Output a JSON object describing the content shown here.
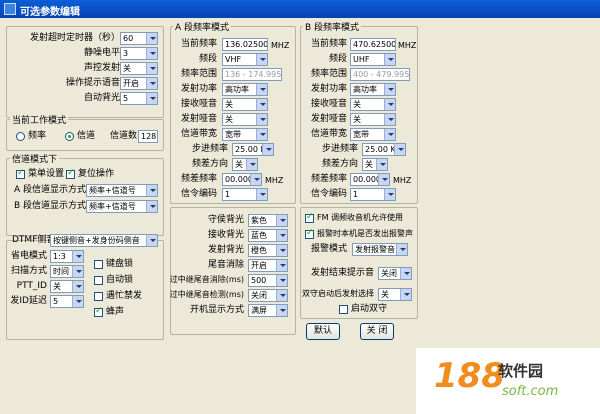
{
  "window": {
    "title": "可选参数编辑"
  },
  "general": {
    "tx_timer_label": "发射超时定时器（秒）",
    "tx_timer_value": "60",
    "squelch_label": "静噪电平",
    "squelch_value": "3",
    "vox_label": "声控发射",
    "vox_value": "关",
    "voice_prompt_label": "操作提示语音",
    "voice_prompt_value": "开启",
    "auto_backlight_label": "自动背光",
    "auto_backlight_value": "5"
  },
  "work_mode": {
    "legend": "当前工作模式",
    "frequency_label": "频率",
    "channel_label": "信道",
    "channel_count_label": "信道数",
    "channel_count_value": "128"
  },
  "channel_mode": {
    "legend": "信道模式下",
    "menu_setting_label": "菜单设置",
    "reset_label": "复位操作",
    "a_display_label": "A 段信道显示方式",
    "a_display_value": "频率+信道号",
    "b_display_label": "B 段信道显示方式",
    "b_display_value": "频率+信道号"
  },
  "a_band": {
    "legend": "A 段频率模式",
    "current_freq_label": "当前频率",
    "current_freq_value": "136.02500",
    "freq_unit": "MHZ",
    "band_label": "频段",
    "band_value": "VHF",
    "range_label": "频率范围",
    "range_value": "136 - 174.9950",
    "power_label": "发射功率",
    "power_value": "高功率",
    "rx_tone_label": "接收哑音",
    "rx_tone_value": "关",
    "tx_tone_label": "发射哑音",
    "tx_tone_value": "关",
    "bandwidth_label": "信道带宽",
    "bandwidth_value": "宽带",
    "step_label": "步进频率",
    "step_value": "25.00 KHZ",
    "offset_dir_label": "频差方向",
    "offset_dir_value": "关",
    "offset_freq_label": "频差频率",
    "offset_freq_value": "00.000M",
    "offset_unit": "MHZ",
    "code_label": "信令编码",
    "code_value": "1"
  },
  "b_band": {
    "legend": "B 段频率模式",
    "current_freq_label": "当前频率",
    "current_freq_value": "470.62500",
    "freq_unit": "MHZ",
    "band_label": "频段",
    "band_value": "UHF",
    "range_label": "频率范围",
    "range_value": "400 - 479.9950",
    "power_label": "发射功率",
    "power_value": "高功率",
    "rx_tone_label": "接收哑音",
    "rx_tone_value": "关",
    "tx_tone_label": "发射哑音",
    "tx_tone_value": "关",
    "bandwidth_label": "信道带宽",
    "bandwidth_value": "宽带",
    "step_label": "步进频率",
    "step_value": "25.00 KHZ",
    "offset_dir_label": "频差方向",
    "offset_dir_value": "关",
    "offset_freq_label": "频差频率",
    "offset_freq_value": "00.000M",
    "offset_unit": "MHZ",
    "code_label": "信令编码",
    "code_value": "1"
  },
  "misc": {
    "dtmf_label": "DTMF侧音",
    "dtmf_value": "按键侧音+发身份码侧音",
    "save_mode_label": "省电模式",
    "save_mode_value": "1:3",
    "scan_mode_label": "扫描方式",
    "scan_mode_value": "时间",
    "ptt_id_label": "PTT_ID",
    "ptt_id_value": "关",
    "id_delay_label": "发ID延迟",
    "id_delay_value": "5",
    "key_lock_label": "键盘锁",
    "auto_lock_label": "自动锁",
    "busy_lock_label": "遇忙禁发",
    "beep_label": "蜂声"
  },
  "display": {
    "standby_bl_label": "守侯背光",
    "standby_bl_value": "紫色",
    "rx_bl_label": "接收背光",
    "rx_bl_value": "蓝色",
    "tx_bl_label": "发射背光",
    "tx_bl_value": "橙色",
    "tail_label": "尾音消除",
    "tail_value": "开启",
    "relay_tail_label": "过中继尾音消除(ms)",
    "relay_tail_value": "500",
    "relay_detect_label": "过中继尾音检测(ms)",
    "relay_detect_value": "关闭",
    "boot_display_label": "开机显示方式",
    "boot_display_value": "满屏"
  },
  "alarm": {
    "fm_label": "FM 调频收音机允许使用",
    "alarm_sound_label": "报警时本机是否发出报警声",
    "alarm_mode_label": "报警模式",
    "alarm_mode_value": "发射报警音",
    "tx_end_label": "发射结束提示音",
    "tx_end_value": "关闭",
    "dual_start_label": "双守启动后发射选择",
    "dual_start_value": "关",
    "start_dual_label": "启动双守"
  },
  "buttons": {
    "ok": "默认",
    "close": "关 闭"
  },
  "watermark": {
    "number": "188",
    "name": "软件园",
    "site": "soft.com"
  }
}
